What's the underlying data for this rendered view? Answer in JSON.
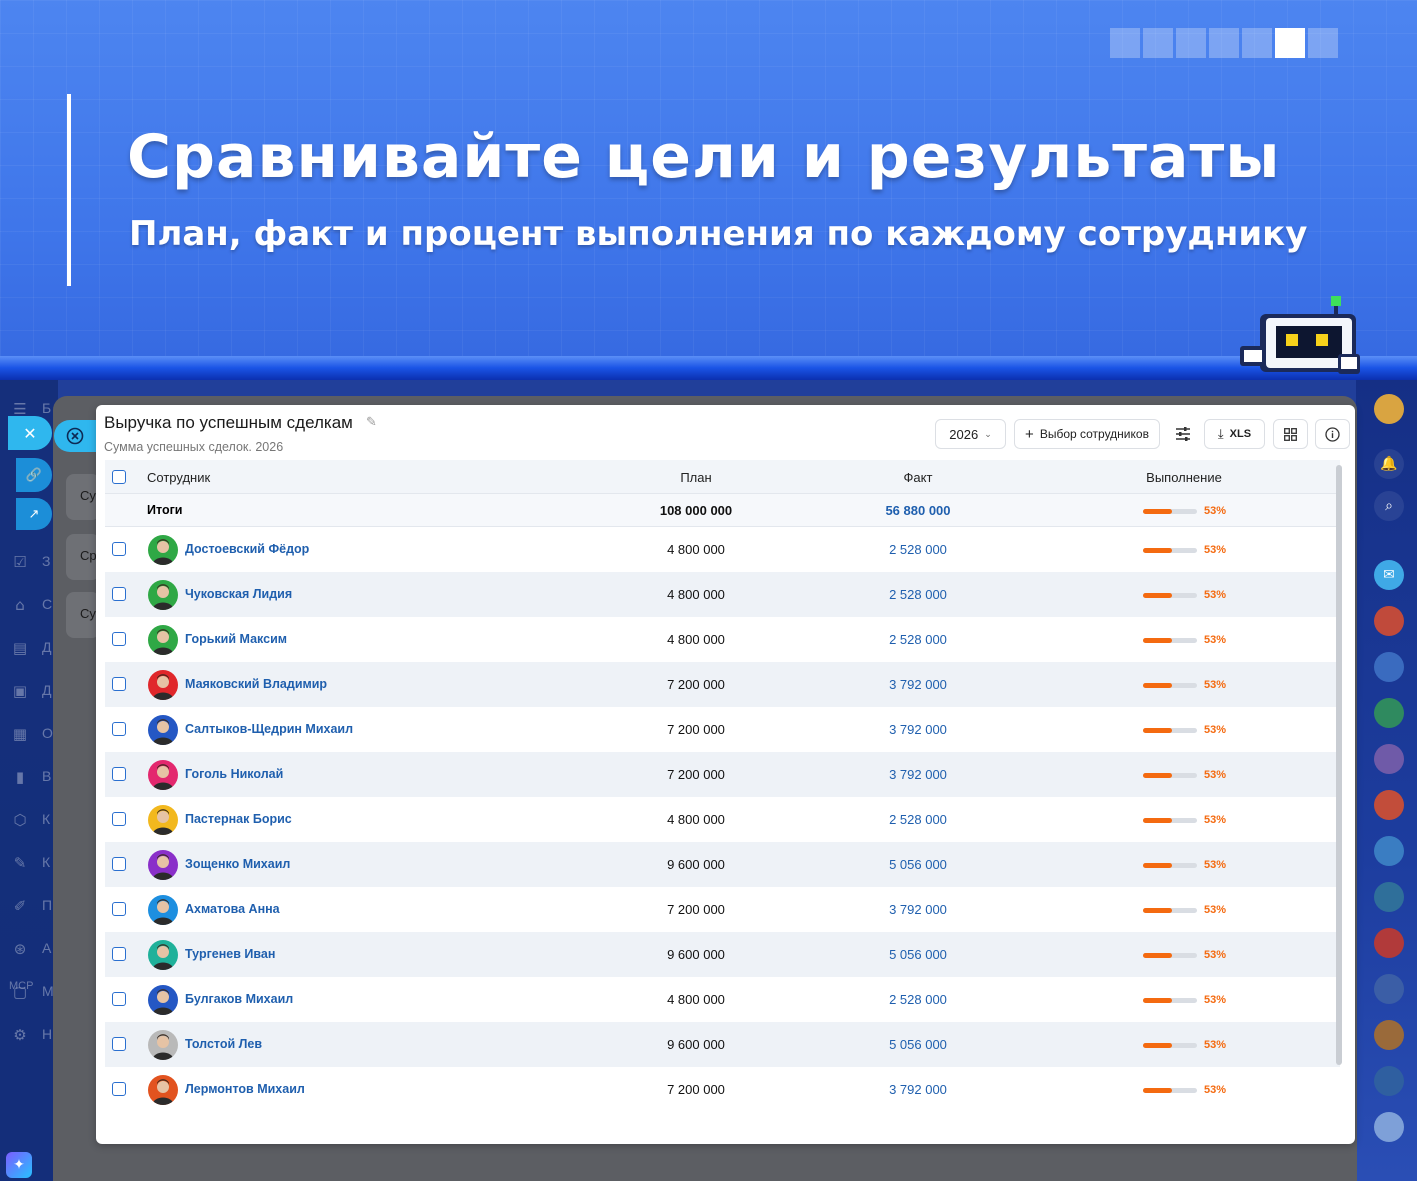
{
  "hero": {
    "title": "Сравнивайте цели и результаты",
    "subtitle": "План, факт и процент выполнения по каждому сотруднику",
    "pager_count": 7,
    "pager_active": 5
  },
  "sidebar_letters": [
    "Б",
    "З",
    "С",
    "Д",
    "Д",
    "О",
    "В",
    "К",
    "К",
    "П",
    "А",
    "М",
    "Н"
  ],
  "sidebar_mcp": "MCP",
  "behind_cards": [
    "Су",
    "Ср",
    "Су"
  ],
  "report": {
    "title": "Выручка по успешным сделкам",
    "subtitle": "Сумма успешных сделок. 2026",
    "year_select": "2026",
    "choose_employees_label": "Выбор сотрудников",
    "export_label": "XLS"
  },
  "table": {
    "columns": {
      "employee": "Сотрудник",
      "plan": "План",
      "fact": "Факт",
      "completion": "Выполнение"
    },
    "totals": {
      "label": "Итоги",
      "plan": "108 000 000",
      "fact": "56 880 000",
      "percent": "53%",
      "progress": 0.53
    },
    "rows": [
      {
        "name": "Достоевский Фёдор",
        "plan": "4 800 000",
        "fact": "2 528 000",
        "percent": "53%",
        "progress": 0.53,
        "avatar_bg": "#2fa845"
      },
      {
        "name": "Чуковская Лидия",
        "plan": "4 800 000",
        "fact": "2 528 000",
        "percent": "53%",
        "progress": 0.53,
        "avatar_bg": "#2fa845"
      },
      {
        "name": "Горький Максим",
        "plan": "4 800 000",
        "fact": "2 528 000",
        "percent": "53%",
        "progress": 0.53,
        "avatar_bg": "#2fa845"
      },
      {
        "name": "Маяковский Владимир",
        "plan": "7 200 000",
        "fact": "3 792 000",
        "percent": "53%",
        "progress": 0.53,
        "avatar_bg": "#e0272b"
      },
      {
        "name": "Салтыков-Щедрин Михаил",
        "plan": "7 200 000",
        "fact": "3 792 000",
        "percent": "53%",
        "progress": 0.53,
        "avatar_bg": "#2457c4"
      },
      {
        "name": "Гоголь Николай",
        "plan": "7 200 000",
        "fact": "3 792 000",
        "percent": "53%",
        "progress": 0.53,
        "avatar_bg": "#e3286e"
      },
      {
        "name": "Пастернак Борис",
        "plan": "4 800 000",
        "fact": "2 528 000",
        "percent": "53%",
        "progress": 0.53,
        "avatar_bg": "#f2b81e"
      },
      {
        "name": "Зощенко Михаил",
        "plan": "9 600 000",
        "fact": "5 056 000",
        "percent": "53%",
        "progress": 0.53,
        "avatar_bg": "#8a2fc9"
      },
      {
        "name": "Ахматова Анна",
        "plan": "7 200 000",
        "fact": "3 792 000",
        "percent": "53%",
        "progress": 0.53,
        "avatar_bg": "#1d8fe0"
      },
      {
        "name": "Тургенев Иван",
        "plan": "9 600 000",
        "fact": "5 056 000",
        "percent": "53%",
        "progress": 0.53,
        "avatar_bg": "#1fb19a"
      },
      {
        "name": "Булгаков Михаил",
        "plan": "4 800 000",
        "fact": "2 528 000",
        "percent": "53%",
        "progress": 0.53,
        "avatar_bg": "#2457c4"
      },
      {
        "name": "Толстой Лев",
        "plan": "9 600 000",
        "fact": "5 056 000",
        "percent": "53%",
        "progress": 0.53,
        "avatar_bg": "#b9b9b9"
      },
      {
        "name": "Лермонтов Михаил",
        "plan": "7 200 000",
        "fact": "3 792 000",
        "percent": "53%",
        "progress": 0.53,
        "avatar_bg": "#e2531f"
      }
    ]
  },
  "right_avatars": [
    "#c04a3b",
    "#3a6bbf",
    "#2f8a5f",
    "#6f5aa8",
    "#c24d3a",
    "#3a7dc2",
    "#2f6f9a",
    "#b13a3a",
    "#3b5ea6",
    "#9a6a3a",
    "#2f5fa0",
    "#7ea0d8"
  ]
}
